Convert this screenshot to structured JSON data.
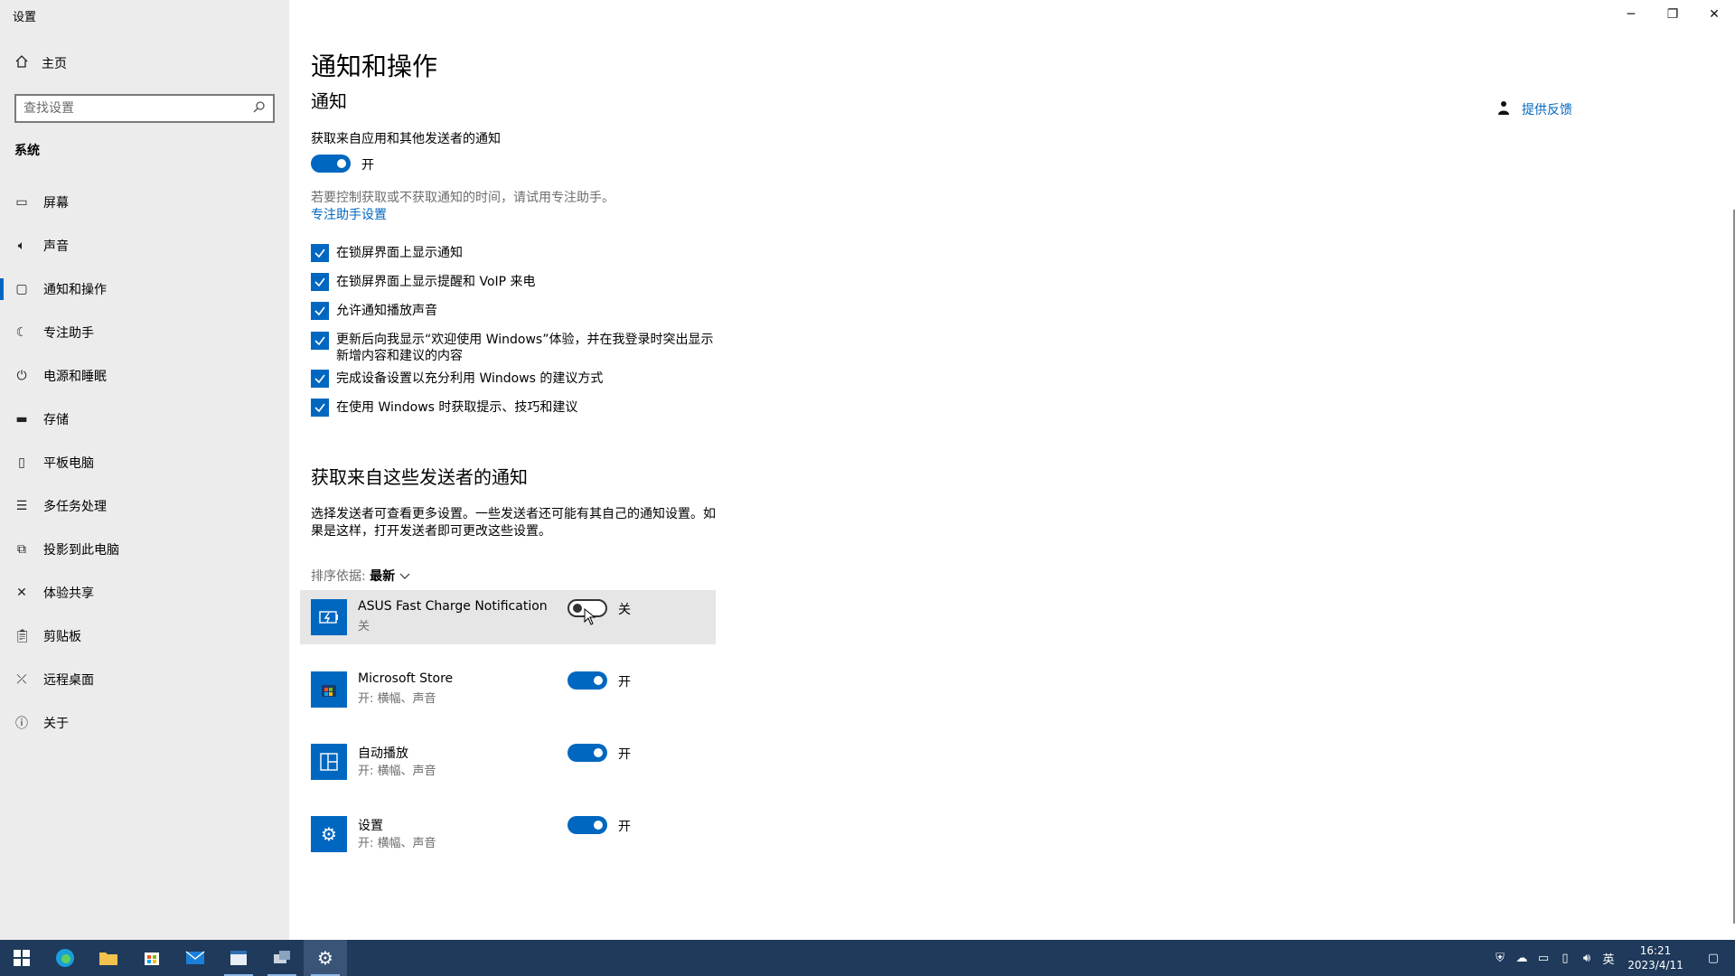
{
  "window": {
    "title": "设置",
    "controls": {
      "minimize": "─",
      "restore": "❐",
      "close": "✕"
    }
  },
  "sidebar": {
    "home": {
      "icon": "home-icon",
      "label": "主页"
    },
    "search": {
      "placeholder": "查找设置"
    },
    "section": "系统",
    "items": [
      {
        "icon": "display-icon",
        "label": "屏幕"
      },
      {
        "icon": "speaker-icon",
        "label": "声音"
      },
      {
        "icon": "notification-icon",
        "label": "通知和操作",
        "active": true
      },
      {
        "icon": "moon-icon",
        "label": "专注助手"
      },
      {
        "icon": "power-icon",
        "label": "电源和睡眠"
      },
      {
        "icon": "storage-icon",
        "label": "存储"
      },
      {
        "icon": "tablet-icon",
        "label": "平板电脑"
      },
      {
        "icon": "multitask-icon",
        "label": "多任务处理"
      },
      {
        "icon": "project-icon",
        "label": "投影到此电脑"
      },
      {
        "icon": "share-icon",
        "label": "体验共享"
      },
      {
        "icon": "clipboard-icon",
        "label": "剪贴板"
      },
      {
        "icon": "remote-desktop-icon",
        "label": "远程桌面"
      },
      {
        "icon": "info-icon",
        "label": "关于"
      }
    ]
  },
  "main": {
    "title": "通知和操作",
    "subtitle": "通知",
    "get_notifications_label": "获取来自应用和其他发送者的通知",
    "master_toggle": {
      "state": "开",
      "on": true
    },
    "focus_hint": "若要控制获取或不获取通知的时间，请试用专注助手。",
    "focus_link": "专注助手设置",
    "checkboxes": [
      {
        "label": "在锁屏界面上显示通知",
        "checked": true
      },
      {
        "label": "在锁屏界面上显示提醒和 VoIP 来电",
        "checked": true
      },
      {
        "label": "允许通知播放声音",
        "checked": true
      },
      {
        "label": "更新后向我显示“欢迎使用 Windows”体验，并在我登录时突出显示",
        "label2": "新增内容和建议的内容",
        "checked": true
      },
      {
        "label": "完成设备设置以充分利用 Windows 的建议方式",
        "checked": true
      },
      {
        "label": "在使用 Windows 时获取提示、技巧和建议",
        "checked": true
      }
    ],
    "senders_title": "获取来自这些发送者的通知",
    "senders_desc": "选择发送者可查看更多设置。一些发送者还可能有其自己的通知设置。如果是这样，打开发送者即可更改这些设置。",
    "sort_label": "排序依据:",
    "sort_value": "最新",
    "senders": [
      {
        "name": "ASUS Fast Charge Notification",
        "sub": "关",
        "state": "关",
        "on": false,
        "icon": "charge-icon"
      },
      {
        "name": "Microsoft Store",
        "sub": "开: 横幅、声音",
        "state": "开",
        "on": true,
        "icon": "store-icon"
      },
      {
        "name": "自动播放",
        "sub": "开: 横幅、声音",
        "state": "开",
        "on": true,
        "icon": "autoplay-icon"
      },
      {
        "name": "设置",
        "sub": "开: 横幅、声音",
        "state": "开",
        "on": true,
        "icon": "gear-icon"
      }
    ],
    "feedback": {
      "icon": "feedback-icon",
      "label": "提供反馈"
    }
  },
  "taskbar": {
    "apps": [
      "start-icon",
      "edge-icon",
      "file-explorer-icon",
      "store-icon",
      "mail-icon",
      "app-icon",
      "network-app-icon",
      "settings-icon"
    ],
    "tray": {
      "language": "英",
      "time": "16:21",
      "date": "2023/4/11"
    }
  },
  "colors": {
    "accent": "#0067c0",
    "sidebar_bg": "#ececec",
    "taskbar_bg": "#1f3a5a"
  }
}
